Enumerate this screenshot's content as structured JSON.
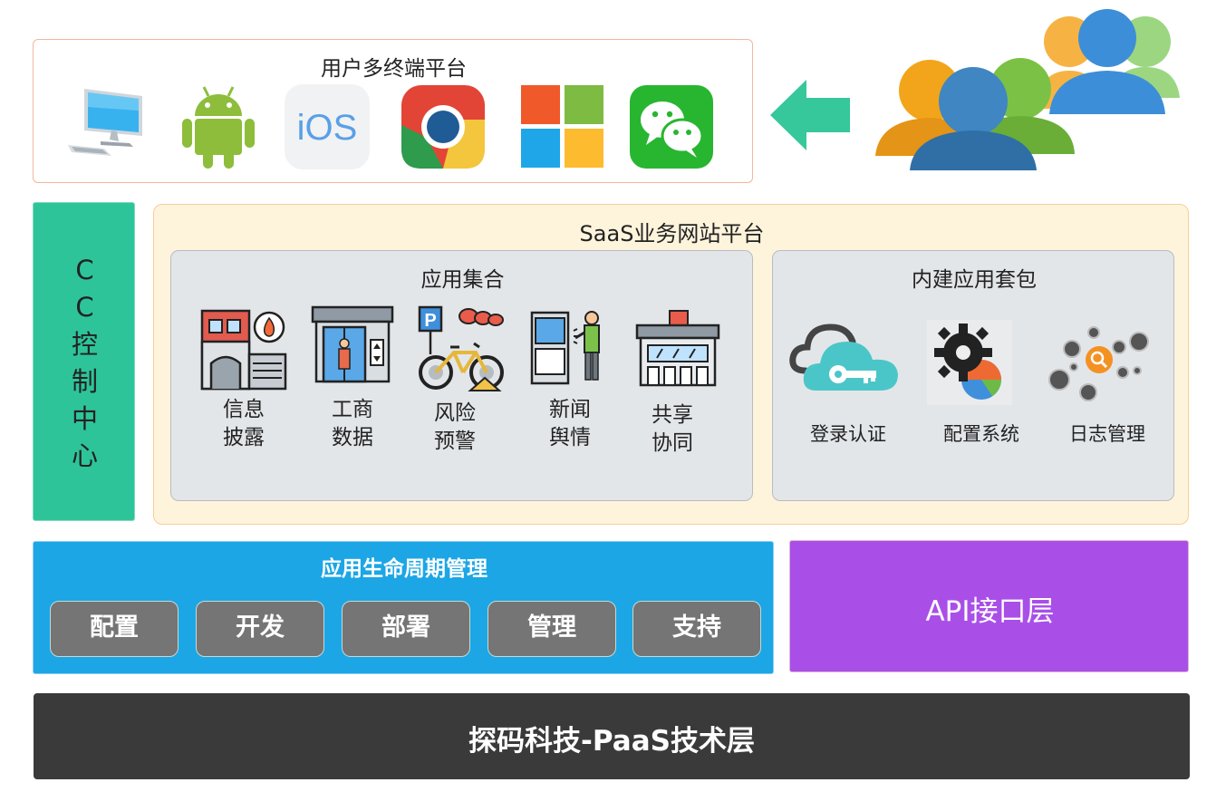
{
  "terminal_platform": {
    "title": "用户多终端平台",
    "icons": [
      "desktop-computer-icon",
      "android-icon",
      "ios-icon",
      "chrome-icon",
      "windows-icon",
      "wechat-icon"
    ],
    "ios_text": "iOS"
  },
  "users_icon": "users-group-icon",
  "arrow_icon": "left-arrow-icon",
  "cc_center": {
    "label": "C\nC\n控\n制\n中\n心"
  },
  "saas": {
    "title": "SaaS业务网站平台",
    "app_collection": {
      "title": "应用集合",
      "items": [
        {
          "label": "信息\n披露",
          "icon": "building-fire-icon"
        },
        {
          "label": "工商\n数据",
          "icon": "elevator-icon"
        },
        {
          "label": "风险\n预警",
          "icon": "bicycle-parking-icon"
        },
        {
          "label": "新闻\n舆情",
          "icon": "kiosk-person-icon"
        },
        {
          "label": "共享\n协同",
          "icon": "shop-icon"
        }
      ]
    },
    "builtin_suite": {
      "title": "内建应用套包",
      "items": [
        {
          "label": "登录认证",
          "icon": "cloud-key-icon"
        },
        {
          "label": "配置系统",
          "icon": "gear-config-icon"
        },
        {
          "label": "日志管理",
          "icon": "log-search-icon"
        }
      ]
    }
  },
  "lifecycle": {
    "title": "应用生命周期管理",
    "buttons": [
      "配置",
      "开发",
      "部署",
      "管理",
      "支持"
    ]
  },
  "api_layer": {
    "label": "API接口层"
  },
  "paas_layer": {
    "label": "探码科技-PaaS技术层"
  },
  "colors": {
    "cc_green": "#2ec49a",
    "lifecycle_blue": "#1ca6e6",
    "api_purple": "#a94fe8",
    "paas_dark": "#3a3a3a",
    "saas_bg": "#fef4dc"
  }
}
